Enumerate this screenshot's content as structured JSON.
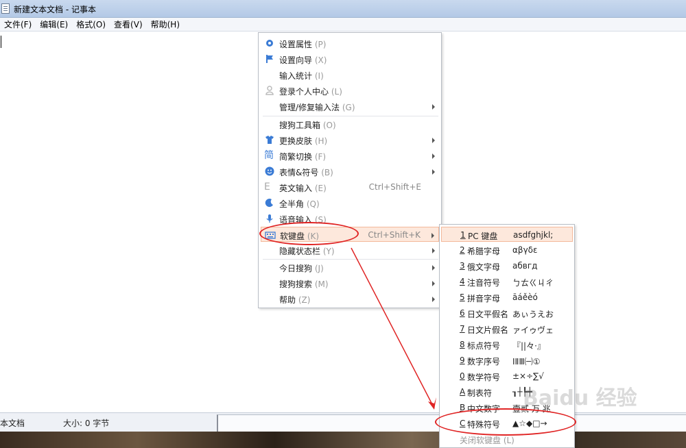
{
  "window": {
    "title": "新建文本文档 - 记事本"
  },
  "menubar": [
    "文件(F)",
    "编辑(E)",
    "格式(O)",
    "查看(V)",
    "帮助(H)"
  ],
  "status": {
    "left": "本文档",
    "size": "大小: 0 字节"
  },
  "context_menu": {
    "items": [
      {
        "label": "设置属性",
        "shortcut": "(P)",
        "icon": "gear-icon"
      },
      {
        "label": "设置向导",
        "shortcut": "(X)",
        "icon": "flag-icon"
      },
      {
        "label": "输入统计",
        "shortcut": "(I)"
      },
      {
        "label": "登录个人中心",
        "shortcut": "(L)",
        "icon": "user-icon"
      },
      {
        "label": "管理/修复输入法",
        "shortcut": "(G)"
      },
      {
        "label": "搜狗工具箱",
        "shortcut": "(O)"
      },
      {
        "label": "更换皮肤",
        "shortcut": "(H)",
        "icon": "shirt-icon"
      },
      {
        "label": "简繁切换",
        "shortcut": "(F)",
        "icon": "jian-icon"
      },
      {
        "label": "表情&符号",
        "shortcut": "(B)",
        "icon": "smiley-icon"
      },
      {
        "label": "英文输入",
        "shortcut": "(E)",
        "icon": "e-icon",
        "keys": "Ctrl+Shift+E"
      },
      {
        "label": "全半角",
        "shortcut": "(Q)",
        "icon": "moon-icon"
      },
      {
        "label": "语音输入",
        "shortcut": "(S)",
        "icon": "mic-icon"
      },
      {
        "label": "软键盘",
        "shortcut": "(K)",
        "icon": "keyboard-icon",
        "keys": "Ctrl+Shift+K"
      },
      {
        "label": "隐藏状态栏",
        "shortcut": "(Y)"
      },
      {
        "label": "今日搜狗",
        "shortcut": "(J)"
      },
      {
        "label": "搜狗搜索",
        "shortcut": "(M)"
      },
      {
        "label": "帮助",
        "shortcut": "(Z)"
      }
    ]
  },
  "submenu": {
    "items": [
      {
        "key": "1",
        "name": "PC 键盘",
        "preview": "asdfghjkl;"
      },
      {
        "key": "2",
        "name": "希腊字母",
        "preview": "αβγδε"
      },
      {
        "key": "3",
        "name": "俄文字母",
        "preview": "абвгд"
      },
      {
        "key": "4",
        "name": "注音符号",
        "preview": "ㄅㄊㄍㄐㄔ"
      },
      {
        "key": "5",
        "name": "拼音字母",
        "preview": "āáěèó"
      },
      {
        "key": "6",
        "name": "日文平假名",
        "preview": "あぃうえお"
      },
      {
        "key": "7",
        "name": "日文片假名",
        "preview": "ァイゥヴェ"
      },
      {
        "key": "8",
        "name": "标点符号",
        "preview": "『||々·』"
      },
      {
        "key": "9",
        "name": "数字序号",
        "preview": "ⅠⅡⅢ㈠①"
      },
      {
        "key": "0",
        "name": "数学符号",
        "preview": "±×÷∑√"
      },
      {
        "key": "A",
        "name": "制表符",
        "preview": "┒┼┡┿"
      },
      {
        "key": "B",
        "name": "中文数字",
        "preview": "壹贰 万 兆"
      },
      {
        "key": "C",
        "name": "特殊符号",
        "preview": "▲☆◆□→"
      },
      {
        "key": "",
        "name": "关闭软键盘 (L)",
        "preview": ""
      }
    ]
  },
  "watermark": "Baidu 经验",
  "colors": {
    "annotation": "#e02424",
    "highlight": "#fde8dc"
  }
}
